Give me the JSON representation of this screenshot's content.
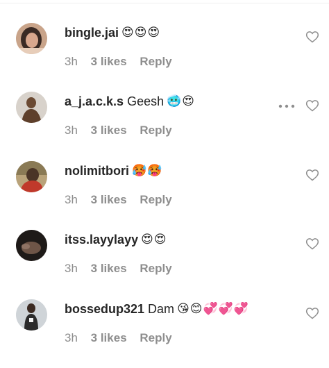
{
  "comments": [
    {
      "username": "bingle.jai",
      "text": "",
      "emoji": "😍😍😍",
      "time": "3h",
      "likes": "3 likes",
      "reply": "Reply"
    },
    {
      "username": "a_j.a.c.k.s",
      "text": "Geesh",
      "emoji": "🥶😍",
      "time": "3h",
      "likes": "3 likes",
      "reply": "Reply"
    },
    {
      "username": "nolimitbori",
      "text": "",
      "emoji": "🥵🥵",
      "time": "3h",
      "likes": "3 likes",
      "reply": "Reply"
    },
    {
      "username": "itss.layylayy",
      "text": "",
      "emoji": "😍😍",
      "time": "3h",
      "likes": "3 likes",
      "reply": "Reply"
    },
    {
      "username": "bossedup321",
      "text": "Dam",
      "emoji": "😘😊💞💞💞",
      "time": "3h",
      "likes": "3 likes",
      "reply": "Reply"
    }
  ],
  "icons": {
    "like": "heart-outline-icon",
    "more": "more-options-icon"
  },
  "colors": {
    "text": "#262626",
    "meta": "#8e8e8e",
    "icon": "#8e8e8e"
  }
}
